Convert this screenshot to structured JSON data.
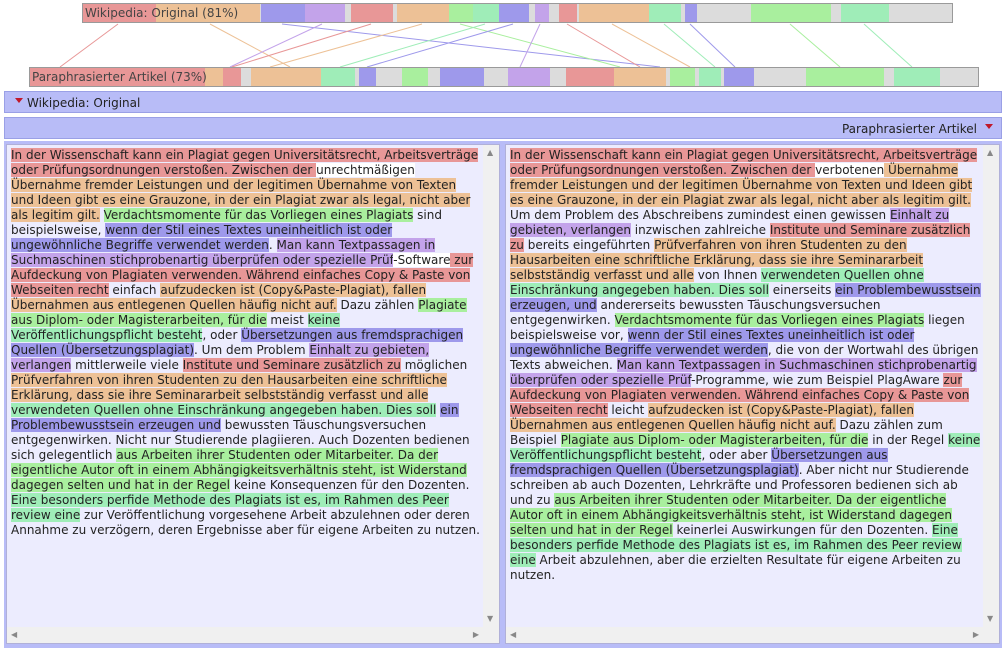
{
  "overview": {
    "original_label": "Wikipedia: Original (81%)",
    "paraphrased_label": "Paraphrasierter Artikel (73%)"
  },
  "colors": {
    "c1": "#e89797",
    "c2": "#edc196",
    "c3": "#9fedb8",
    "c4": "#a9ef9e",
    "c5": "#c3a3ea",
    "c6": "#9e99eb",
    "gap": "#dcdcdc",
    "header": "#b8bcf7",
    "textbg": "#ececfe",
    "arrow": "#c0182a"
  },
  "panels": {
    "left_title": "Wikipedia: Original",
    "right_title": "Paraphrasierter Artikel"
  },
  "left_text": [
    {
      "t": "In der Wissenschaft kann ein Plagiat gegen Universitätsrecht, Arbeitsverträge oder Prüfungsordnungen verstoßen. Zwischen der ",
      "c": "c1"
    },
    {
      "t": "unrechtmäßigen",
      "c": "c7"
    },
    {
      "t": " Übernahme fremder Leistungen und der legitimen Übernahme von Texten und Ideen gibt es eine Grauzone, in der ein Plagiat zwar als legal, nicht aber als legitim gilt.",
      "c": "c2"
    },
    {
      "t": " ",
      "c": ""
    },
    {
      "t": "Verdachtsmomente für das Vorliegen eines Plagiats",
      "c": "c4"
    },
    {
      "t": " sind beispielsweise, ",
      "c": ""
    },
    {
      "t": "wenn der Stil eines Textes uneinheitlich ist oder ungewöhnliche Begriffe verwendet werden",
      "c": "c6"
    },
    {
      "t": ". ",
      "c": ""
    },
    {
      "t": "Man kann Textpassagen in Suchmaschinen stichprobenartig überprüfen oder spezielle Prüf",
      "c": "c5"
    },
    {
      "t": "-Software",
      "c": "c7"
    },
    {
      "t": " zur Aufdeckung von Plagiaten verwenden. Während einfaches Copy & Paste von Webseiten recht",
      "c": "c1"
    },
    {
      "t": " einfach ",
      "c": ""
    },
    {
      "t": "aufzudecken ist (Copy&Paste-Plagiat), fallen Übernahmen aus entlegenen Quellen häufig nicht auf.",
      "c": "c2"
    },
    {
      "t": " Dazu zählen ",
      "c": ""
    },
    {
      "t": "Plagiate aus Diplom- oder Magisterarbeiten, für die",
      "c": "c4"
    },
    {
      "t": " meist ",
      "c": ""
    },
    {
      "t": "keine Veröffentlichungspflicht besteht",
      "c": "c3"
    },
    {
      "t": ", oder ",
      "c": ""
    },
    {
      "t": "Übersetzungen aus fremdsprachigen Quellen (Übersetzungsplagiat)",
      "c": "c6"
    },
    {
      "t": ". Um dem Problem ",
      "c": ""
    },
    {
      "t": "Einhalt zu gebieten, verlangen",
      "c": "c5"
    },
    {
      "t": " mittlerweile viele ",
      "c": ""
    },
    {
      "t": "Institute und Seminare zusätzlich zu",
      "c": "c1"
    },
    {
      "t": " möglichen ",
      "c": ""
    },
    {
      "t": "Prüfverfahren von ihren Studenten zu den Hausarbeiten eine schriftliche Erklärung, dass sie ihre Seminararbeit selbstständig verfasst und alle",
      "c": "c2"
    },
    {
      "t": " ",
      "c": ""
    },
    {
      "t": "verwendeten Quellen ohne Einschränkung angegeben haben. Dies soll",
      "c": "c3"
    },
    {
      "t": " ",
      "c": ""
    },
    {
      "t": "ein Problembewusstsein erzeugen und",
      "c": "c6"
    },
    {
      "t": " bewussten Täuschungsversuchen entgegenwirken. Nicht nur Studierende plagiieren. Auch Dozenten bedienen sich gelegentlich ",
      "c": ""
    },
    {
      "t": "aus Arbeiten ihrer Studenten oder Mitarbeiter. Da der eigentliche Autor oft in einem Abhängigkeitsverhältnis steht, ist Widerstand dagegen selten und hat in der Regel",
      "c": "c4"
    },
    {
      "t": " keine Konsequenzen für den Dozenten. ",
      "c": ""
    },
    {
      "t": "Eine besonders perfide Methode des Plagiats ist es, im Rahmen des Peer review eine",
      "c": "c3"
    },
    {
      "t": " zur Veröffentlichung vorgesehene Arbeit abzulehnen oder deren Annahme zu verzögern, deren Ergebnisse aber für eigene Arbeiten zu nutzen.",
      "c": ""
    }
  ],
  "right_text": [
    {
      "t": "In der Wissenschaft kann ein Plagiat gegen Universitätsrecht, Arbeitsverträge oder Prüfungsordnungen verstoßen. Zwischen der ",
      "c": "c1"
    },
    {
      "t": "verbotenen",
      "c": "c7"
    },
    {
      "t": " Übernahme fremder Leistungen und der legitimen Übernahme von Texten und Ideen gibt es eine Grauzone, in der ein Plagiat zwar als legal, nicht aber als legitim gilt.",
      "c": "c2"
    },
    {
      "t": " Um dem Problem des Abschreibens zumindest einen gewissen ",
      "c": ""
    },
    {
      "t": "Einhalt zu gebieten, verlangen",
      "c": "c5"
    },
    {
      "t": " inzwischen zahlreiche ",
      "c": ""
    },
    {
      "t": "Institute und Seminare zusätzlich zu",
      "c": "c1"
    },
    {
      "t": " bereits eingeführten ",
      "c": ""
    },
    {
      "t": "Prüfverfahren von ihren Studenten zu den Hausarbeiten eine schriftliche Erklärung, dass sie ihre Seminararbeit selbstständig verfasst und alle",
      "c": "c2"
    },
    {
      "t": " von Ihnen ",
      "c": ""
    },
    {
      "t": "verwendeten Quellen ohne Einschränkung angegeben haben. Dies soll",
      "c": "c3"
    },
    {
      "t": " einerseits ",
      "c": ""
    },
    {
      "t": "ein Problembewusstsein erzeugen, und",
      "c": "c6"
    },
    {
      "t": " andererseits bewussten Täuschungsversuchen entgegenwirken. ",
      "c": ""
    },
    {
      "t": "Verdachtsmomente für das Vorliegen eines Plagiats",
      "c": "c4"
    },
    {
      "t": " liegen beispielsweise vor, ",
      "c": ""
    },
    {
      "t": "wenn der Stil eines Textes uneinheitlich ist oder ungewöhnliche Begriffe verwendet werden",
      "c": "c6"
    },
    {
      "t": ", die von der Wortwahl des übrigen Texts abweichen. ",
      "c": ""
    },
    {
      "t": "Man kann Textpassagen in Suchmaschinen stichprobenartig überprüfen oder spezielle Prüf",
      "c": "c5"
    },
    {
      "t": "-Programme, wie zum Beispiel PlagAware ",
      "c": ""
    },
    {
      "t": "zur Aufdeckung von Plagiaten verwenden. Während einfaches Copy & Paste von Webseiten recht",
      "c": "c1"
    },
    {
      "t": " leicht ",
      "c": ""
    },
    {
      "t": "aufzudecken ist (Copy&Paste-Plagiat), fallen Übernahmen aus entlegenen Quellen häufig nicht auf.",
      "c": "c2"
    },
    {
      "t": " Dazu zählen zum Beispiel ",
      "c": ""
    },
    {
      "t": "Plagiate aus Diplom- oder Magisterarbeiten, für die",
      "c": "c4"
    },
    {
      "t": " in der Regel ",
      "c": ""
    },
    {
      "t": "keine Veröffentlichungspflicht besteht",
      "c": "c3"
    },
    {
      "t": ", oder aber ",
      "c": ""
    },
    {
      "t": "Übersetzungen aus fremdsprachigen Quellen (Übersetzungsplagiat)",
      "c": "c6"
    },
    {
      "t": ". Aber nicht nur Studierende schreiben ab auch Dozenten, Lehrkräfte und Professoren bedienen sich ab und zu ",
      "c": ""
    },
    {
      "t": "aus Arbeiten ihrer Studenten oder Mitarbeiter. Da der eigentliche Autor oft in einem Abhängigkeitsverhältnis steht, ist Widerstand dagegen selten und hat in der Regel",
      "c": "c4"
    },
    {
      "t": " keinerlei Auswirkungen für den Dozenten. ",
      "c": ""
    },
    {
      "t": "Eine besonders perfide Methode des Plagiats ist es, im Rahmen des Peer review eine",
      "c": "c3"
    },
    {
      "t": " Arbeit abzulehnen, aber die erzielten Resultate für eigene Arbeiten zu nutzen.",
      "c": ""
    }
  ]
}
